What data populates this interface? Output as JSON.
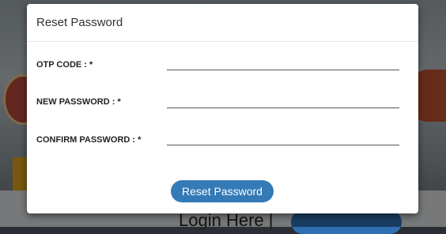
{
  "background": {
    "login_text": "Login Here |"
  },
  "modal": {
    "title": "Reset Password",
    "fields": [
      {
        "label": "OTP CODE : *",
        "value": ""
      },
      {
        "label": "NEW PASSWORD : *",
        "value": ""
      },
      {
        "label": "CONFIRM PASSWORD : *",
        "value": ""
      }
    ],
    "submit_label": "Reset Password"
  },
  "colors": {
    "button": "#337ab7",
    "overlay": "rgba(0,0,0,0.45)"
  }
}
